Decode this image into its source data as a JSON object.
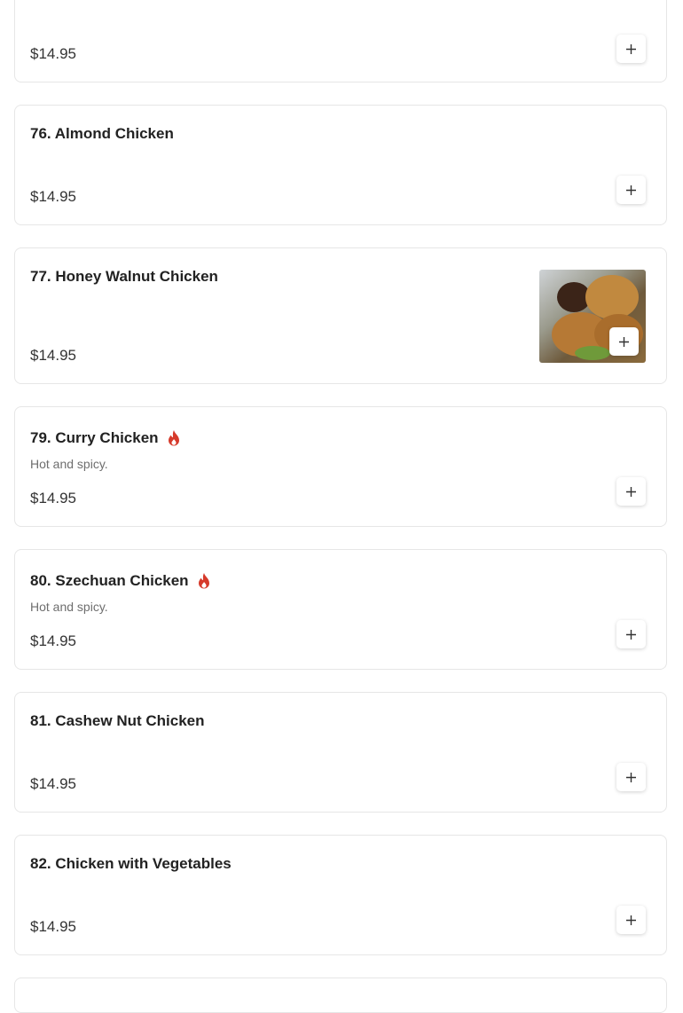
{
  "colors": {
    "accent_flame": "#d63a2b",
    "border": "#e6e6e6",
    "price_text": "#333333"
  },
  "add_icon": "plus-icon",
  "spicy_icon": "flame-icon",
  "items": [
    {
      "name": "",
      "description": "",
      "price": "$14.95",
      "spicy": false,
      "has_image": false
    },
    {
      "name": "76. Almond Chicken",
      "description": "",
      "price": "$14.95",
      "spicy": false,
      "has_image": false
    },
    {
      "name": "77. Honey Walnut Chicken",
      "description": "",
      "price": "$14.95",
      "spicy": false,
      "has_image": true
    },
    {
      "name": "79. Curry Chicken",
      "description": "Hot and spicy.",
      "price": "$14.95",
      "spicy": true,
      "has_image": false
    },
    {
      "name": "80. Szechuan Chicken",
      "description": "Hot and spicy.",
      "price": "$14.95",
      "spicy": true,
      "has_image": false
    },
    {
      "name": "81. Cashew Nut Chicken",
      "description": "",
      "price": "$14.95",
      "spicy": false,
      "has_image": false
    },
    {
      "name": "82. Chicken with Vegetables",
      "description": "",
      "price": "$14.95",
      "spicy": false,
      "has_image": false
    }
  ]
}
